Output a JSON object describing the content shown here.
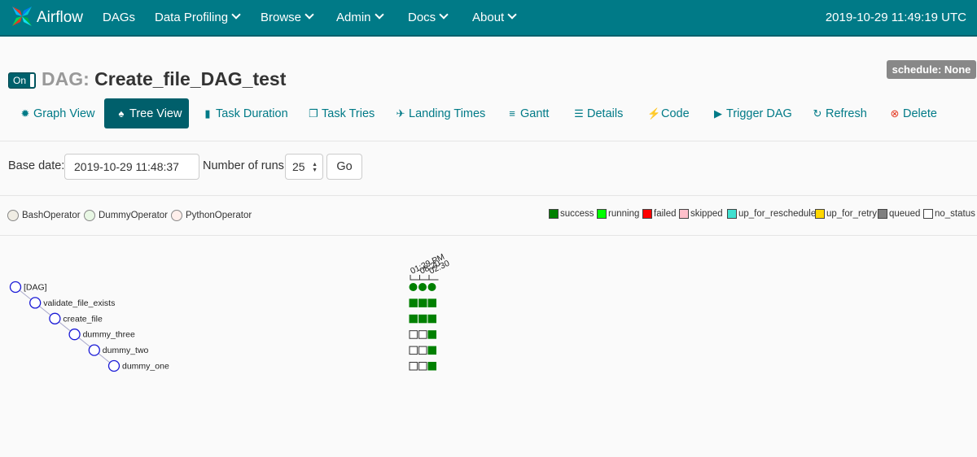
{
  "navbar": {
    "brand": "Airflow",
    "items": [
      {
        "label": "DAGs",
        "dropdown": false
      },
      {
        "label": "Data Profiling",
        "dropdown": true
      },
      {
        "label": "Browse",
        "dropdown": true
      },
      {
        "label": "Admin",
        "dropdown": true
      },
      {
        "label": "Docs",
        "dropdown": true
      },
      {
        "label": "About",
        "dropdown": true
      }
    ],
    "time": "2019-10-29 11:49:19 UTC"
  },
  "header": {
    "toggle_label": "On",
    "dag_prefix": "DAG:",
    "dag_id": "Create_file_DAG_test",
    "schedule": "schedule: None"
  },
  "tabs": [
    {
      "label": "Graph View",
      "icon": "graph-icon",
      "glyph": "✹"
    },
    {
      "label": "Tree View",
      "icon": "tree-icon",
      "glyph": "⬮",
      "active": true
    },
    {
      "label": "Task Duration",
      "icon": "bar-chart-icon",
      "glyph": "▮"
    },
    {
      "label": "Task Tries",
      "icon": "duplicate-icon",
      "glyph": "❐"
    },
    {
      "label": "Landing Times",
      "icon": "plane-icon",
      "glyph": "✈"
    },
    {
      "label": "Gantt",
      "icon": "gantt-icon",
      "glyph": "≡"
    },
    {
      "label": "Details",
      "icon": "list-icon",
      "glyph": "☰"
    },
    {
      "label": "Code",
      "icon": "flash-icon",
      "glyph": "⚡"
    },
    {
      "label": "Trigger DAG",
      "icon": "play-circle-icon",
      "glyph": "▶"
    },
    {
      "label": "Refresh",
      "icon": "refresh-icon",
      "glyph": "↻"
    },
    {
      "label": "Delete",
      "icon": "remove-circle-icon",
      "glyph": "⊗"
    }
  ],
  "form": {
    "base_date_label": "Base date:",
    "base_date_value": "2019-10-29 11:48:37",
    "runs_label": "Number of runs:",
    "runs_value": "25",
    "go_label": "Go"
  },
  "operator_legend": [
    {
      "label": "BashOperator",
      "color": "#f0ede4"
    },
    {
      "label": "DummyOperator",
      "color": "#e8f7e4"
    },
    {
      "label": "PythonOperator",
      "color": "#ffefeb"
    }
  ],
  "state_legend": [
    {
      "label": "success",
      "color": "#008000"
    },
    {
      "label": "running",
      "color": "#00ff00"
    },
    {
      "label": "failed",
      "color": "#ff0000"
    },
    {
      "label": "skipped",
      "color": "#ffc0cb"
    },
    {
      "label": "up_for_reschedule",
      "color": "#40e0d0"
    },
    {
      "label": "up_for_retry",
      "color": "#ffd700"
    },
    {
      "label": "queued",
      "color": "#808080"
    },
    {
      "label": "no_status",
      "color": "#ffffff"
    }
  ],
  "tree": {
    "run_header_labels": [
      "01:29 PM",
      "08:20",
      "02:30"
    ],
    "nodes": [
      {
        "label": "[DAG]",
        "states": [
          "success",
          "success",
          "success"
        ]
      },
      {
        "label": "validate_file_exists",
        "states": [
          "success",
          "success",
          "success"
        ]
      },
      {
        "label": "create_file",
        "states": [
          "success",
          "success",
          "success"
        ]
      },
      {
        "label": "dummy_three",
        "states": [
          "no_status",
          "no_status",
          "success"
        ]
      },
      {
        "label": "dummy_two",
        "states": [
          "no_status",
          "no_status",
          "success"
        ]
      },
      {
        "label": "dummy_one",
        "states": [
          "no_status",
          "no_status",
          "success"
        ]
      }
    ],
    "state_colors": {
      "success": "#008000",
      "no_status": "#ffffff"
    }
  }
}
